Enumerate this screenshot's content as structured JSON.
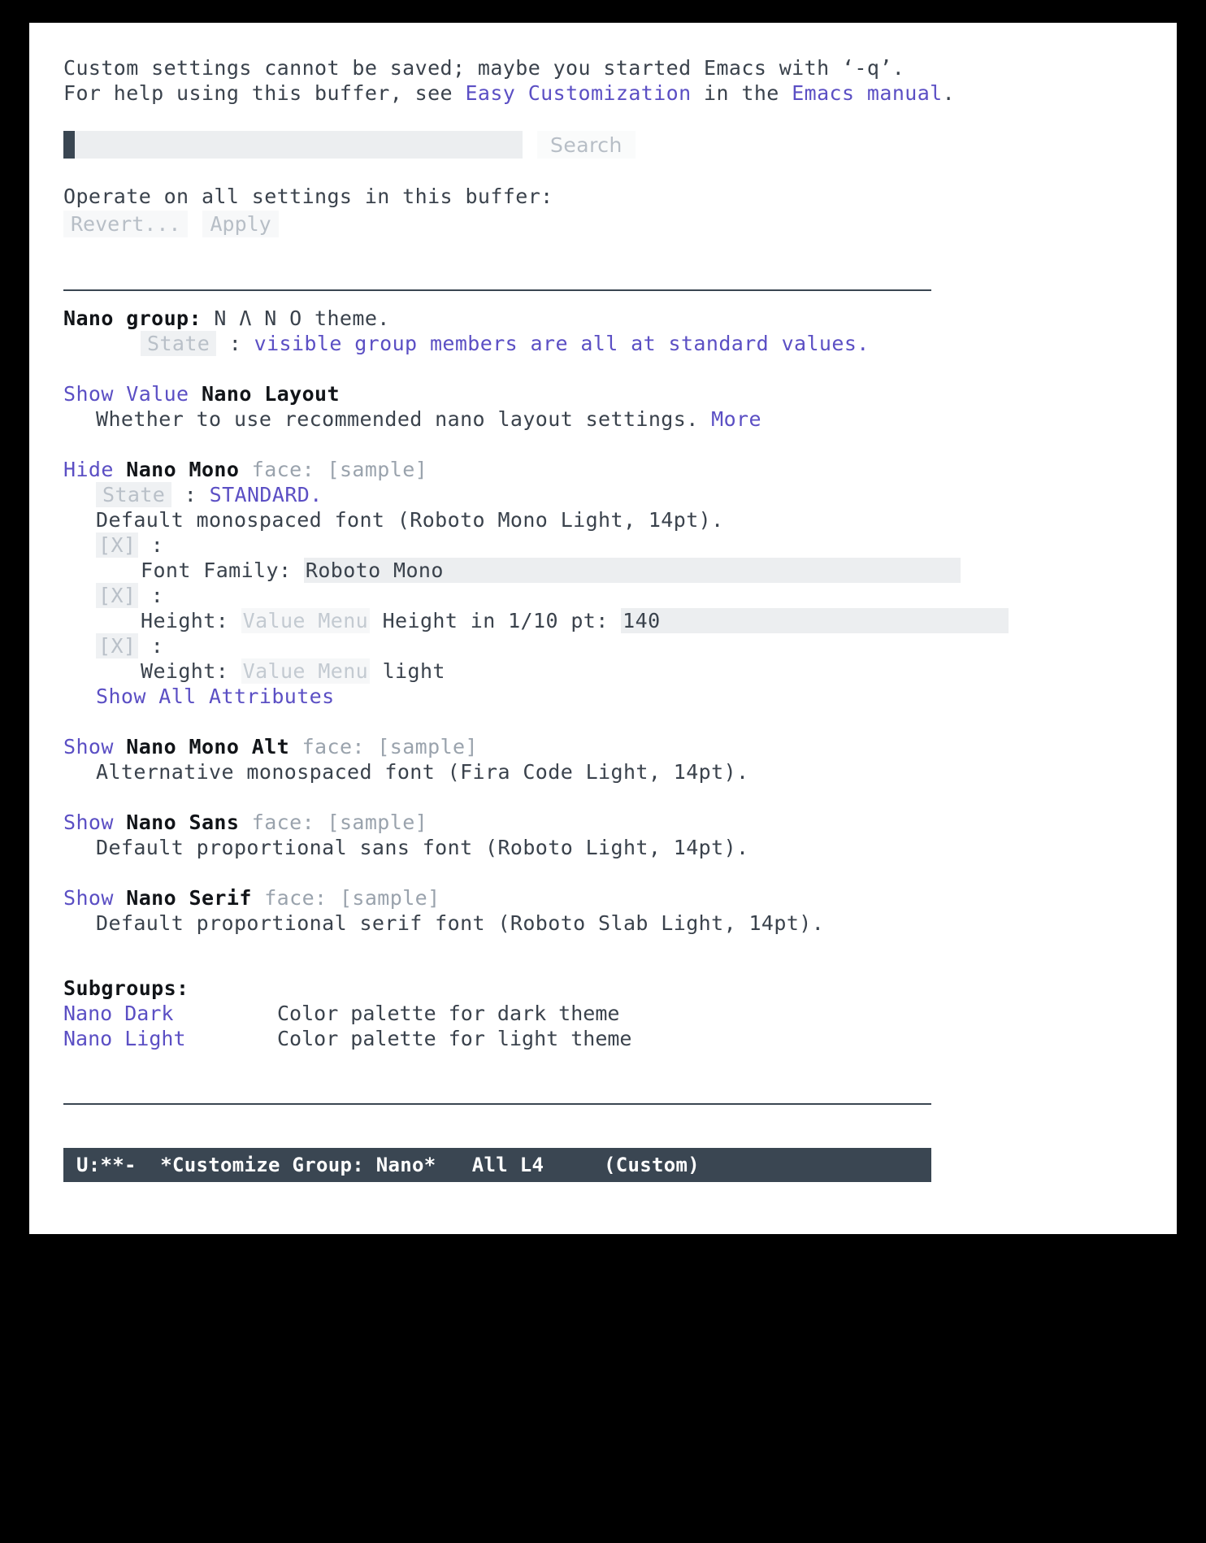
{
  "buffer": {
    "notice_line1": "Custom settings cannot be saved; maybe you started Emacs with ‘-q’.",
    "help_prefix": "For help using this buffer, see ",
    "help_link1": "Easy Customization",
    "help_middle": " in the ",
    "help_link2": "Emacs manual",
    "help_suffix": "."
  },
  "search": {
    "value": "",
    "button_label": "Search"
  },
  "operate": {
    "heading": "Operate on all settings in this buffer:",
    "revert_label": "Revert...",
    "apply_label": "Apply"
  },
  "group": {
    "label": "Nano group:",
    "title": " N Λ N O theme.",
    "state_label": "State",
    "state_sep": " : ",
    "state_value": "visible group members are all at standard values."
  },
  "layout_setting": {
    "toggle_label": "Show Value",
    "name": "Nano Layout",
    "doc_text": "Whether to use recommended nano layout settings. ",
    "more_link": "More"
  },
  "nano_mono": {
    "toggle_label": "Hide",
    "name": "Nano Mono",
    "face_word": " face: ",
    "sample": "[sample]",
    "state_label": "State",
    "state_sep": " : ",
    "state_value": "STANDARD.",
    "doc": "Default monospaced font (Roboto Mono Light, 14pt).",
    "checkbox": "[X]",
    "colon": " :",
    "attributes": [
      {
        "label": "Font Family: ",
        "menu": "",
        "value": "Roboto Mono"
      },
      {
        "label": "Height: ",
        "menu": "Value Menu",
        "value_prefix": " Height in 1/10 pt: ",
        "value": "140"
      },
      {
        "label": "Weight: ",
        "menu": "Value Menu",
        "value": " light"
      }
    ],
    "show_all_link": "Show All Attributes"
  },
  "faces": [
    {
      "toggle_label": "Show",
      "name": "Nano Mono Alt",
      "face_word": " face: ",
      "sample": "[sample]",
      "doc": "Alternative monospaced font (Fira Code Light, 14pt)."
    },
    {
      "toggle_label": "Show",
      "name": "Nano Sans",
      "face_word": " face: ",
      "sample": "[sample]",
      "doc": "Default proportional sans font (Roboto Light, 14pt)."
    },
    {
      "toggle_label": "Show",
      "name": "Nano Serif",
      "face_word": " face: ",
      "sample": "[sample]",
      "doc": "Default proportional serif font (Roboto Slab Light, 14pt)."
    }
  ],
  "subgroups": {
    "heading": "Subgroups:",
    "items": [
      {
        "name": "Nano Dark",
        "desc": "Color palette for dark theme"
      },
      {
        "name": "Nano Light",
        "desc": "Color palette for light theme"
      }
    ]
  },
  "modeline": {
    "status": "U:**-",
    "buffer_name": "*Customize Group: Nano*",
    "position": "All L4",
    "mode": "(Custom)",
    "text": "U:**-  *Customize Group: Nano*   All L4     (Custom)"
  },
  "colors": {
    "link": "#5b4fc4",
    "text": "#3a424c",
    "muted": "#b9c0c8",
    "field_bg": "#eceef0",
    "modeline_bg": "#3a4652"
  }
}
